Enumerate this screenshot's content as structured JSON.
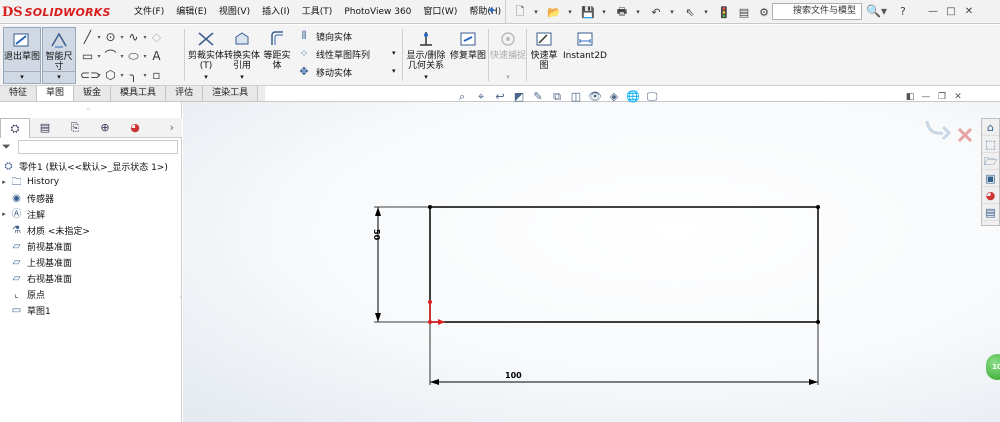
{
  "app": {
    "logo_ds": "DS",
    "logo_text": "SOLIDWORKS",
    "menu": [
      "文件(F)",
      "编辑(E)",
      "视图(V)",
      "插入(I)",
      "工具(T)",
      "PhotoView 360",
      "窗口(W)",
      "帮助(H)"
    ],
    "search_placeholder": "搜索文件与模型",
    "help_label": "?",
    "win_controls": [
      "—",
      "□",
      "✕"
    ]
  },
  "ribbon": {
    "exit_sketch": "退出草图",
    "smart_dimension": "智能尺寸",
    "trim": "剪裁实体(T)",
    "convert": "转换实体引用",
    "offset": "等距实体",
    "mirror": "镜向实体",
    "linear_pattern": "线性草图阵列",
    "move": "移动实体",
    "relations": "显示/删除几何关系",
    "repair": "修复草图",
    "quick_snaps": "快速捕捉",
    "rapid_sketch": "快速草图",
    "instant2d": "Instant2D"
  },
  "tabs": [
    "特征",
    "草图",
    "钣金",
    "模具工具",
    "评估",
    "渲染工具"
  ],
  "active_tab": "草图",
  "tree": {
    "root": "零件1 (默认<<默认>_显示状态 1>)",
    "items": [
      "History",
      "传感器",
      "注解",
      "材质 <未指定>",
      "前视基准面",
      "上视基准面",
      "右视基准面",
      "原点",
      "草图1"
    ]
  },
  "sketch": {
    "width_dim": "100",
    "height_dim": "50"
  },
  "badge": "10",
  "colors": {
    "brand": "#d81e1e",
    "sketch_line": "#000000",
    "origin": "#e02020",
    "pressed": "#cfd8e3"
  }
}
